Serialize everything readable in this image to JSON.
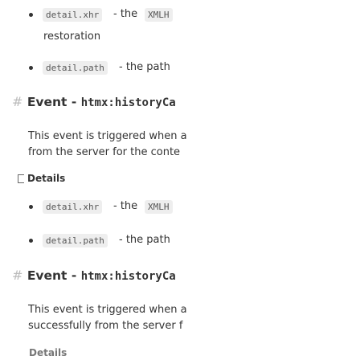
{
  "section1": {
    "items": [
      {
        "code": "detail.xhr",
        "sep": "- the",
        "tail": "XMLH",
        "continuation": "restoration"
      },
      {
        "code": "detail.path",
        "sep": "- the path"
      }
    ]
  },
  "event1": {
    "hash": "#",
    "label": "Event -",
    "code": "htmx:historyCa",
    "para_line1": "This event is triggered when a",
    "para_line2": "from the server for the conte",
    "details_label": "Details",
    "items": [
      {
        "code": "detail.xhr",
        "sep": "- the",
        "tail": "XMLH"
      },
      {
        "code": "detail.path",
        "sep": "- the path"
      }
    ]
  },
  "event2": {
    "hash": "#",
    "label": "Event -",
    "code": "htmx:historyCa",
    "para_line1": "This event is triggered when a",
    "para_line2": "successfully from the server f",
    "details_label": "Details"
  }
}
